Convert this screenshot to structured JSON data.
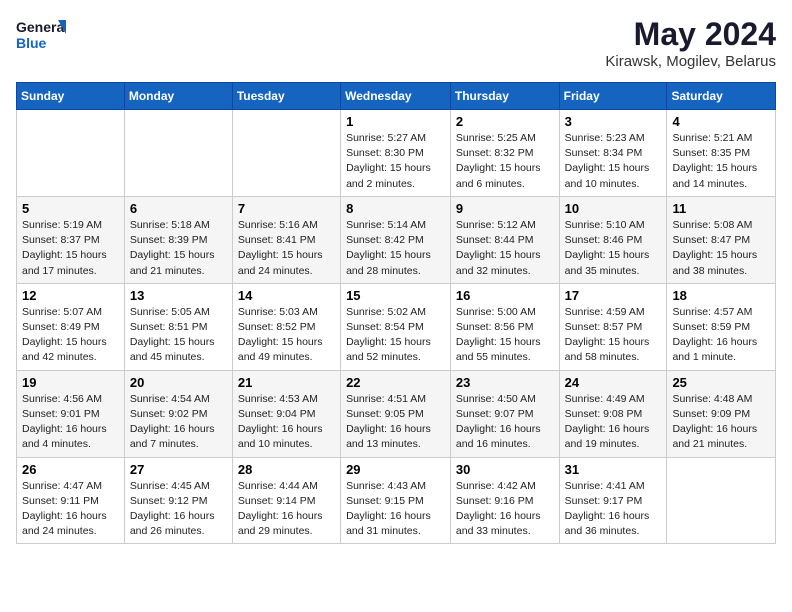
{
  "header": {
    "logo_general": "General",
    "logo_blue": "Blue",
    "title": "May 2024",
    "subtitle": "Kirawsk, Mogilev, Belarus"
  },
  "calendar": {
    "weekdays": [
      "Sunday",
      "Monday",
      "Tuesday",
      "Wednesday",
      "Thursday",
      "Friday",
      "Saturday"
    ],
    "weeks": [
      [
        {
          "day": "",
          "info": ""
        },
        {
          "day": "",
          "info": ""
        },
        {
          "day": "",
          "info": ""
        },
        {
          "day": "1",
          "info": "Sunrise: 5:27 AM\nSunset: 8:30 PM\nDaylight: 15 hours\nand 2 minutes."
        },
        {
          "day": "2",
          "info": "Sunrise: 5:25 AM\nSunset: 8:32 PM\nDaylight: 15 hours\nand 6 minutes."
        },
        {
          "day": "3",
          "info": "Sunrise: 5:23 AM\nSunset: 8:34 PM\nDaylight: 15 hours\nand 10 minutes."
        },
        {
          "day": "4",
          "info": "Sunrise: 5:21 AM\nSunset: 8:35 PM\nDaylight: 15 hours\nand 14 minutes."
        }
      ],
      [
        {
          "day": "5",
          "info": "Sunrise: 5:19 AM\nSunset: 8:37 PM\nDaylight: 15 hours\nand 17 minutes."
        },
        {
          "day": "6",
          "info": "Sunrise: 5:18 AM\nSunset: 8:39 PM\nDaylight: 15 hours\nand 21 minutes."
        },
        {
          "day": "7",
          "info": "Sunrise: 5:16 AM\nSunset: 8:41 PM\nDaylight: 15 hours\nand 24 minutes."
        },
        {
          "day": "8",
          "info": "Sunrise: 5:14 AM\nSunset: 8:42 PM\nDaylight: 15 hours\nand 28 minutes."
        },
        {
          "day": "9",
          "info": "Sunrise: 5:12 AM\nSunset: 8:44 PM\nDaylight: 15 hours\nand 32 minutes."
        },
        {
          "day": "10",
          "info": "Sunrise: 5:10 AM\nSunset: 8:46 PM\nDaylight: 15 hours\nand 35 minutes."
        },
        {
          "day": "11",
          "info": "Sunrise: 5:08 AM\nSunset: 8:47 PM\nDaylight: 15 hours\nand 38 minutes."
        }
      ],
      [
        {
          "day": "12",
          "info": "Sunrise: 5:07 AM\nSunset: 8:49 PM\nDaylight: 15 hours\nand 42 minutes."
        },
        {
          "day": "13",
          "info": "Sunrise: 5:05 AM\nSunset: 8:51 PM\nDaylight: 15 hours\nand 45 minutes."
        },
        {
          "day": "14",
          "info": "Sunrise: 5:03 AM\nSunset: 8:52 PM\nDaylight: 15 hours\nand 49 minutes."
        },
        {
          "day": "15",
          "info": "Sunrise: 5:02 AM\nSunset: 8:54 PM\nDaylight: 15 hours\nand 52 minutes."
        },
        {
          "day": "16",
          "info": "Sunrise: 5:00 AM\nSunset: 8:56 PM\nDaylight: 15 hours\nand 55 minutes."
        },
        {
          "day": "17",
          "info": "Sunrise: 4:59 AM\nSunset: 8:57 PM\nDaylight: 15 hours\nand 58 minutes."
        },
        {
          "day": "18",
          "info": "Sunrise: 4:57 AM\nSunset: 8:59 PM\nDaylight: 16 hours\nand 1 minute."
        }
      ],
      [
        {
          "day": "19",
          "info": "Sunrise: 4:56 AM\nSunset: 9:01 PM\nDaylight: 16 hours\nand 4 minutes."
        },
        {
          "day": "20",
          "info": "Sunrise: 4:54 AM\nSunset: 9:02 PM\nDaylight: 16 hours\nand 7 minutes."
        },
        {
          "day": "21",
          "info": "Sunrise: 4:53 AM\nSunset: 9:04 PM\nDaylight: 16 hours\nand 10 minutes."
        },
        {
          "day": "22",
          "info": "Sunrise: 4:51 AM\nSunset: 9:05 PM\nDaylight: 16 hours\nand 13 minutes."
        },
        {
          "day": "23",
          "info": "Sunrise: 4:50 AM\nSunset: 9:07 PM\nDaylight: 16 hours\nand 16 minutes."
        },
        {
          "day": "24",
          "info": "Sunrise: 4:49 AM\nSunset: 9:08 PM\nDaylight: 16 hours\nand 19 minutes."
        },
        {
          "day": "25",
          "info": "Sunrise: 4:48 AM\nSunset: 9:09 PM\nDaylight: 16 hours\nand 21 minutes."
        }
      ],
      [
        {
          "day": "26",
          "info": "Sunrise: 4:47 AM\nSunset: 9:11 PM\nDaylight: 16 hours\nand 24 minutes."
        },
        {
          "day": "27",
          "info": "Sunrise: 4:45 AM\nSunset: 9:12 PM\nDaylight: 16 hours\nand 26 minutes."
        },
        {
          "day": "28",
          "info": "Sunrise: 4:44 AM\nSunset: 9:14 PM\nDaylight: 16 hours\nand 29 minutes."
        },
        {
          "day": "29",
          "info": "Sunrise: 4:43 AM\nSunset: 9:15 PM\nDaylight: 16 hours\nand 31 minutes."
        },
        {
          "day": "30",
          "info": "Sunrise: 4:42 AM\nSunset: 9:16 PM\nDaylight: 16 hours\nand 33 minutes."
        },
        {
          "day": "31",
          "info": "Sunrise: 4:41 AM\nSunset: 9:17 PM\nDaylight: 16 hours\nand 36 minutes."
        },
        {
          "day": "",
          "info": ""
        }
      ]
    ]
  }
}
